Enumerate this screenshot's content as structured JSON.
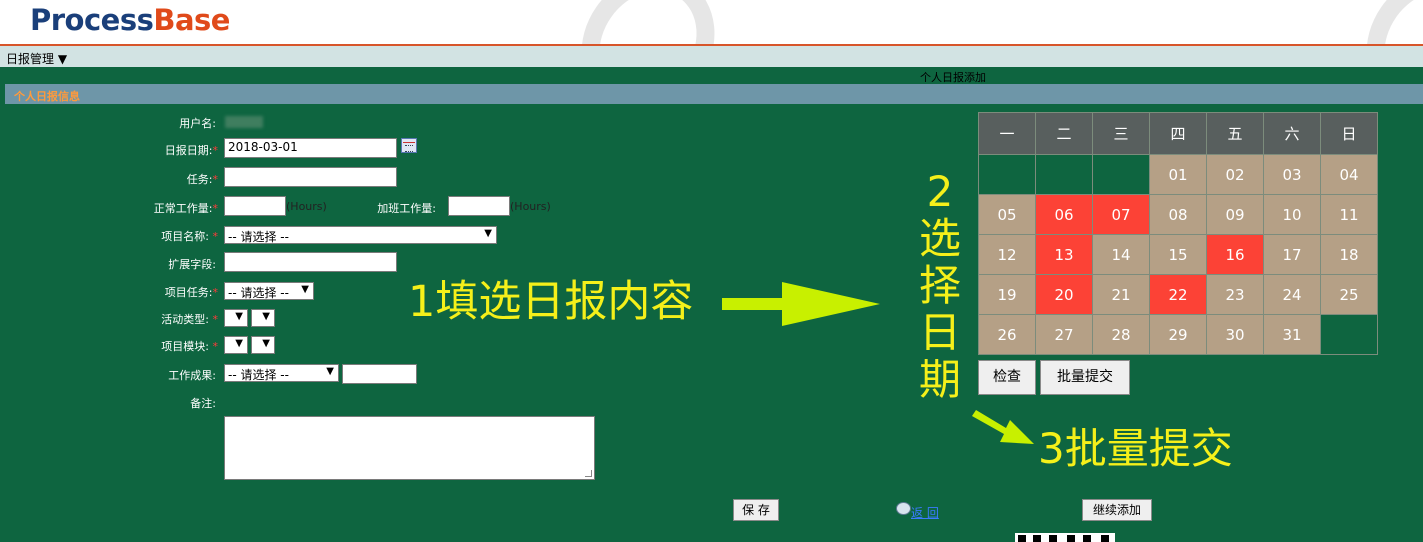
{
  "logo": {
    "part1": "Process",
    "part2": "Base"
  },
  "menu": {
    "item": "日报管理"
  },
  "page_heading": "个人日报添加",
  "section_title": "个人日报信息",
  "form": {
    "username_label": "用户名:",
    "date_label": "日报日期:",
    "date_value": "2018-03-01",
    "task_label": "任务:",
    "normal_hours_label": "正常工作量:",
    "overtime_label": "加班工作量:",
    "hours_unit": "(Hours)",
    "project_label": "项目名称:",
    "project_value": "-- 请选择 --",
    "ext_label": "扩展字段:",
    "project_task_label": "项目任务:",
    "project_task_value": "-- 请选择 --",
    "activity_label": "活动类型:",
    "module_label": "项目模块:",
    "result_label": "工作成果:",
    "result_value": "-- 请选择 --",
    "remark_label": "备注:",
    "required_mark": "*"
  },
  "calendar": {
    "weekdays": [
      "一",
      "二",
      "三",
      "四",
      "五",
      "六",
      "日"
    ],
    "weeks": [
      [
        {
          "d": ""
        },
        {
          "d": ""
        },
        {
          "d": ""
        },
        {
          "d": "01"
        },
        {
          "d": "02"
        },
        {
          "d": "03"
        },
        {
          "d": "04"
        }
      ],
      [
        {
          "d": "05"
        },
        {
          "d": "06",
          "sel": true
        },
        {
          "d": "07",
          "sel": true
        },
        {
          "d": "08"
        },
        {
          "d": "09"
        },
        {
          "d": "10"
        },
        {
          "d": "11"
        }
      ],
      [
        {
          "d": "12"
        },
        {
          "d": "13",
          "sel": true
        },
        {
          "d": "14"
        },
        {
          "d": "15"
        },
        {
          "d": "16",
          "sel": true
        },
        {
          "d": "17"
        },
        {
          "d": "18"
        }
      ],
      [
        {
          "d": "19"
        },
        {
          "d": "20",
          "sel": true
        },
        {
          "d": "21"
        },
        {
          "d": "22",
          "sel": true
        },
        {
          "d": "23"
        },
        {
          "d": "24"
        },
        {
          "d": "25"
        }
      ],
      [
        {
          "d": "26"
        },
        {
          "d": "27"
        },
        {
          "d": "28"
        },
        {
          "d": "29"
        },
        {
          "d": "30"
        },
        {
          "d": "31"
        },
        {
          "d": ""
        }
      ]
    ],
    "colors": {
      "day": "#b5a086",
      "selected": "#fc4236",
      "header": "#585f5e"
    }
  },
  "buttons": {
    "check": "检查",
    "batch_submit": "批量提交",
    "save": "保 存",
    "back": "返 回",
    "continue_add": "继续添加"
  },
  "annotations": {
    "step1": "1填选日报内容",
    "step2_chars": [
      "2",
      "选",
      "择",
      "日",
      "期"
    ],
    "step3": "3批量提交"
  }
}
